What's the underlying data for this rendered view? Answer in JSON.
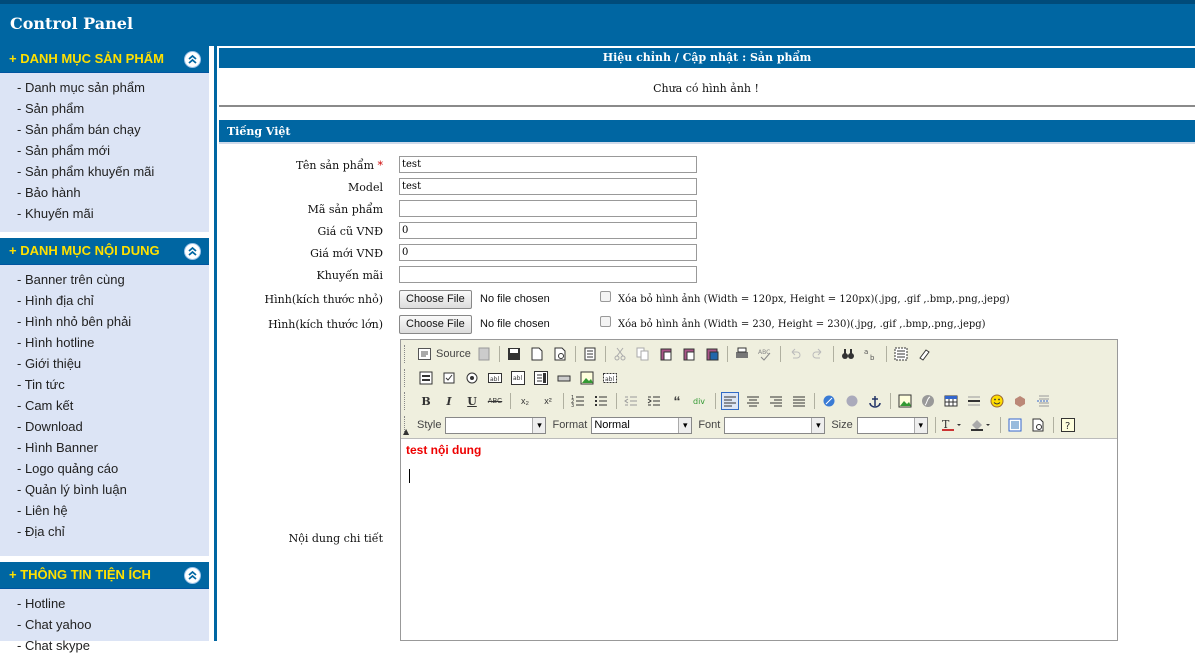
{
  "app_title": "Control Panel",
  "sidebar": {
    "sections": [
      {
        "title": "+ DANH MỤC SẢN PHẨM",
        "items": [
          "- Danh mục sản phẩm",
          "- Sản phẩm",
          "- Sản phẩm bán chạy",
          "- Sản phẩm mới",
          "- Sản phẩm khuyến mãi",
          "- Bảo hành",
          "- Khuyến mãi"
        ]
      },
      {
        "title": "+ DANH MỤC NỘI DUNG",
        "items": [
          "- Banner trên cùng",
          "- Hình địa chỉ",
          "- Hình nhỏ bên phải",
          "- Hình hotline",
          "- Giới thiệu",
          "- Tin tức",
          "- Cam kết",
          "- Download",
          "- Hình Banner",
          "- Logo quảng cáo",
          "- Quản lý bình luận",
          "- Liên hệ",
          "- Địa chỉ"
        ]
      },
      {
        "title": "+ THÔNG TIN TIỆN ÍCH",
        "items": [
          "- Hotline",
          "- Chat yahoo",
          "- Chat skype"
        ]
      }
    ]
  },
  "main": {
    "header": "Hiệu chỉnh / Cập nhật : Sản phẩm",
    "no_image": "Chưa có hình ảnh !",
    "language_tab": "Tiếng Việt",
    "fields": {
      "name": {
        "label": "Tên sản phẩm",
        "required": "*",
        "value": "test"
      },
      "model": {
        "label": "Model",
        "value": "test"
      },
      "code": {
        "label": "Mã sản phẩm",
        "value": ""
      },
      "old_price": {
        "label": "Giá cũ VNĐ",
        "value": "0"
      },
      "new_price": {
        "label": "Giá mới VNĐ",
        "value": "0"
      },
      "promo": {
        "label": "Khuyến mãi",
        "value": ""
      },
      "image_small": {
        "label": "Hình(kích thước nhỏ)",
        "button": "Choose File",
        "status": "No file chosen",
        "delete_label": "Xóa bỏ hình ảnh (Width = 120px, Height = 120px)(.jpg, .gif ,.bmp,.png,.jepg)"
      },
      "image_large": {
        "label": "Hình(kích thước lớn)",
        "button": "Choose File",
        "status": "No file chosen",
        "delete_label": "Xóa bỏ hình ảnh (Width = 230, Height = 230)(.jpg, .gif ,.bmp,.png,.jepg)"
      },
      "content": {
        "label": "Nội dung chi tiết"
      }
    },
    "editor": {
      "source_label": "Source",
      "style_label": "Style",
      "format_label": "Format",
      "format_value": "Normal",
      "font_label": "Font",
      "size_label": "Size",
      "body_text": "test nội dung"
    }
  }
}
